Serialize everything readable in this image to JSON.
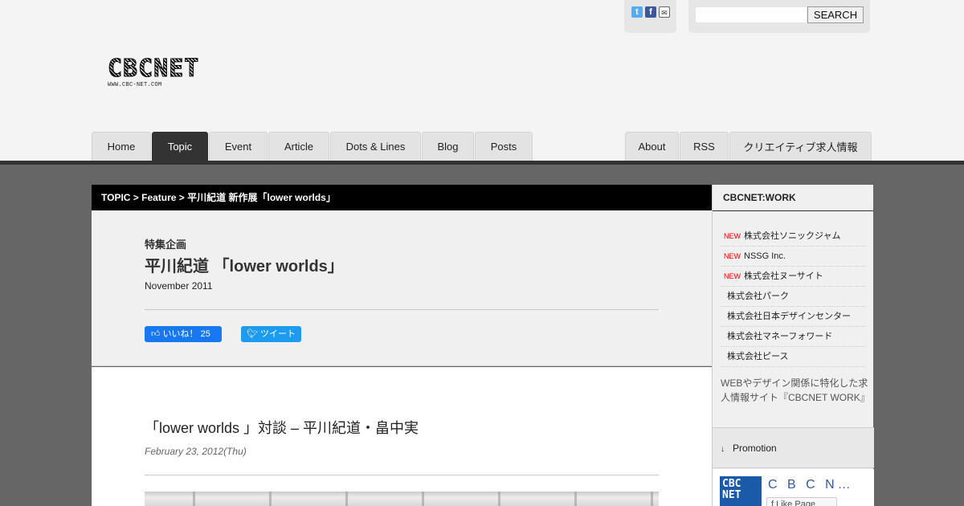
{
  "header": {
    "search": {
      "placeholder": "",
      "button_label": "SEARCH"
    },
    "social_icons": [
      "twitter-icon",
      "facebook-icon",
      "mail-icon"
    ],
    "logo": {
      "text": "CBCNET",
      "url_text": "WWW.CBC-NET.COM"
    }
  },
  "nav": {
    "left": [
      "Home",
      "Topic",
      "Event",
      "Article",
      "Dots & Lines",
      "Blog",
      "Posts"
    ],
    "right": [
      "About",
      "RSS",
      "クリエイティブ求人情報"
    ],
    "active": "Topic"
  },
  "breadcrumb": "TOPIC > Feature > 平川紀道 新作展「lower worlds」",
  "feature": {
    "kicker": "特集企画",
    "title": "平川紀道 「lower worlds」",
    "date": "November 2011",
    "like_label": "いいね！ 25",
    "tweet_label": "ツイート"
  },
  "article": {
    "title": "「lower worlds 」対談 – 平川紀道・畠中実",
    "date": "February 23, 2012(Thu)"
  },
  "sidebar": {
    "heading": "CBCNET:WORK",
    "items": [
      {
        "new": "NEW",
        "label": "株式会社ソニックジャム"
      },
      {
        "new": "NEW",
        "label": "NSSG Inc."
      },
      {
        "new": "NEW",
        "label": "株式会社ヌーサイト"
      },
      {
        "new": "",
        "label": "株式会社パーク"
      },
      {
        "new": "",
        "label": "株式会社日本デザインセンター"
      },
      {
        "new": "",
        "label": "株式会社マネーフォワード"
      },
      {
        "new": "",
        "label": "株式会社ピース"
      }
    ],
    "description": "WEBやデザイン関係に特化した求人情報サイト『CBCNET WORK』",
    "promotion_label": "Promotion",
    "fb": {
      "thumb_text": "CBC NET",
      "name": "C B C N…",
      "like_label": "Like Page"
    }
  },
  "colors": {
    "active_tab": "#333333",
    "breadcrumb_bg": "#000000",
    "new_badge": "#ee0000",
    "body_bg": "#666666"
  }
}
